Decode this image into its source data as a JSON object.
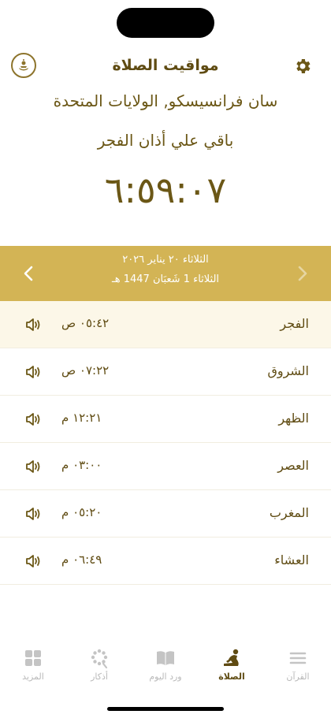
{
  "header": {
    "title": "مواقيت الصلاة",
    "city": "سان فرانسيسكو, الولايات المتحدة",
    "remaining_label": "باقي علي أذان الفجر",
    "countdown": "٦:٥٩:٠٧"
  },
  "date": {
    "gregorian": "الثلاثاء ٢٠ يناير ٢٠٢٦",
    "hijri": "الثلاثاء 1 شَعبَان 1447 هـ"
  },
  "prayers": [
    {
      "name": "الفجر",
      "time": "٠٥:٤٢ ص"
    },
    {
      "name": "الشروق",
      "time": "٠٧:٢٢ ص"
    },
    {
      "name": "الظهر",
      "time": "١٢:٢١ م"
    },
    {
      "name": "العصر",
      "time": "٠٣:٠٠ م"
    },
    {
      "name": "المغرب",
      "time": "٠٥:٢٠ م"
    },
    {
      "name": "العشاء",
      "time": "٠٦:٤٩ م"
    }
  ],
  "tabs": [
    {
      "label": "القرآن",
      "icon": "list-icon"
    },
    {
      "label": "الصلاة",
      "icon": "praying-person-icon"
    },
    {
      "label": "ورد اليوم",
      "icon": "book-icon"
    },
    {
      "label": "أذكار",
      "icon": "prayer-beads-icon"
    },
    {
      "label": "المزيد",
      "icon": "grid-icon"
    }
  ],
  "colors": {
    "accent": "#d3b455",
    "text": "#5f4b12",
    "active_row": "#fcf7e8",
    "inactive_tab": "#b9b9b9"
  }
}
